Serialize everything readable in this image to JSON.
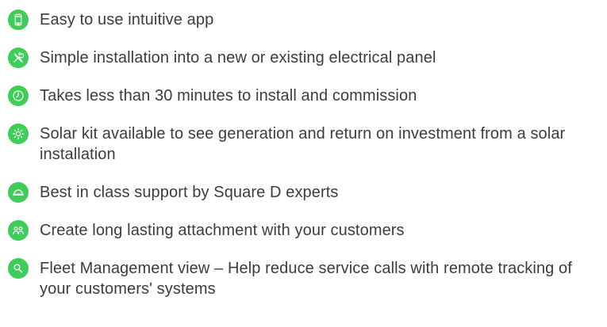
{
  "theme": {
    "accent": "#3dcd58",
    "text_color": "#3c3c3c"
  },
  "features": [
    {
      "icon": "smartphone-icon",
      "text": "Easy to use intuitive app"
    },
    {
      "icon": "tools-icon",
      "text": "Simple installation into a new or existing electrical panel"
    },
    {
      "icon": "clock-icon",
      "text": "Takes less than 30 minutes to install and commission"
    },
    {
      "icon": "sun-icon",
      "text": "Solar kit available to see generation and return on investment from a solar installation"
    },
    {
      "icon": "hard-hat-icon",
      "text": "Best in class support by Square D experts"
    },
    {
      "icon": "people-icon",
      "text": "Create long lasting attachment with your customers"
    },
    {
      "icon": "magnifier-icon",
      "text": "Fleet Management view – Help reduce service calls with remote tracking of your customers' systems"
    }
  ]
}
